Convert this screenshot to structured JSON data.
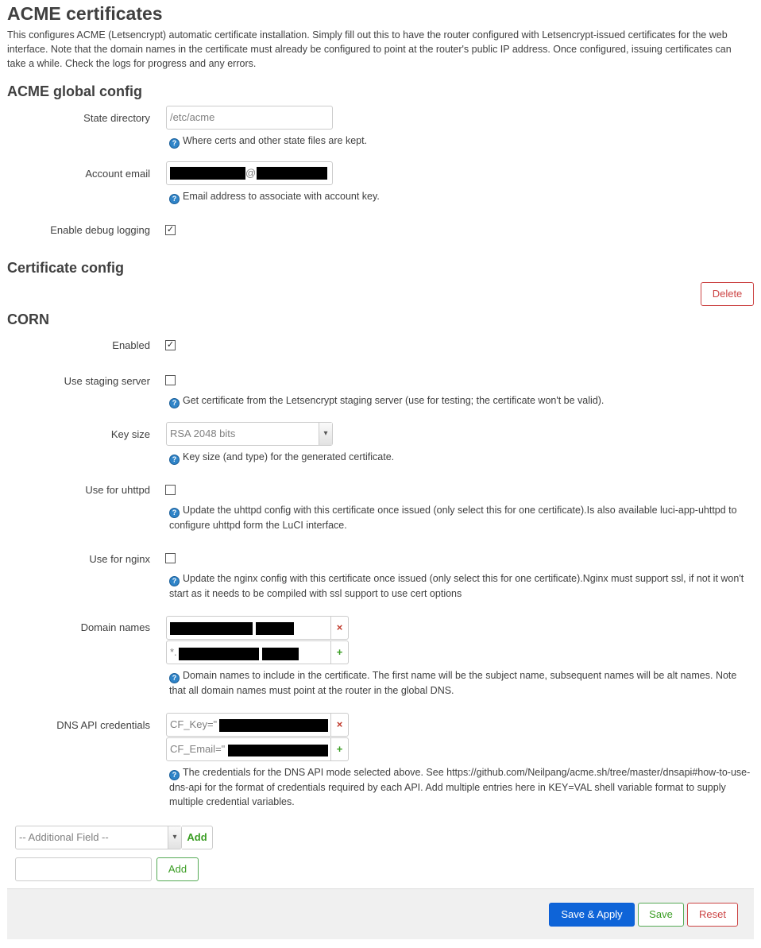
{
  "page": {
    "title": "ACME certificates",
    "description": "This configures ACME (Letsencrypt) automatic certificate installation. Simply fill out this to have the router configured with Letsencrypt-issued certificates for the web interface. Note that the domain names in the certificate must already be configured to point at the router's public IP address. Once configured, issuing certificates can take a while. Check the logs for progress and any errors."
  },
  "global": {
    "heading": "ACME global config",
    "state_dir": {
      "label": "State directory",
      "placeholder": "/etc/acme",
      "hint": "Where certs and other state files are kept."
    },
    "account_email": {
      "label": "Account email",
      "at": "@",
      "hint": "Email address to associate with account key."
    },
    "debug": {
      "label": "Enable debug logging",
      "checked": true
    }
  },
  "cert": {
    "heading": "Certificate config",
    "delete_label": "Delete",
    "section_name": "CORN",
    "enabled": {
      "label": "Enabled",
      "checked": true
    },
    "staging": {
      "label": "Use staging server",
      "checked": false,
      "hint": "Get certificate from the Letsencrypt staging server (use for testing; the certificate won't be valid)."
    },
    "key_size": {
      "label": "Key size",
      "value": "RSA 2048 bits",
      "hint": "Key size (and type) for the generated certificate."
    },
    "uhttpd": {
      "label": "Use for uhttpd",
      "checked": false,
      "hint": "Update the uhttpd config with this certificate once issued (only select this for one certificate).Is also available luci-app-uhttpd to configure uhttpd form the LuCI interface."
    },
    "nginx": {
      "label": "Use for nginx",
      "checked": false,
      "hint": "Update the nginx config with this certificate once issued (only select this for one certificate).Nginx must support ssl, if not it won't start as it needs to be compiled with ssl support to use cert options"
    },
    "domains": {
      "label": "Domain names",
      "entries": [
        {
          "prefix": "",
          "remove": "×"
        },
        {
          "prefix": "*.",
          "add": "+"
        }
      ],
      "hint": "Domain names to include in the certificate. The first name will be the subject name, subsequent names will be alt names. Note that all domain names must point at the router in the global DNS."
    },
    "dns_credentials": {
      "label": "DNS API credentials",
      "entries": [
        {
          "prefix": "CF_Key=\"",
          "remove": "×"
        },
        {
          "prefix": "CF_Email=\"",
          "add": "+"
        }
      ],
      "hint": "The credentials for the DNS API mode selected above. See https://github.com/Neilpang/acme.sh/tree/master/dnsapi#how-to-use-dns-api for the format of credentials required by each API. Add multiple entries here in KEY=VAL shell variable format to supply multiple credential variables."
    }
  },
  "additional": {
    "select_value": "-- Additional Field --",
    "add_label": "Add",
    "add_section_label": "Add"
  },
  "footer": {
    "save_apply": "Save & Apply",
    "save": "Save",
    "reset": "Reset"
  },
  "icons": {
    "help": "?",
    "check": "✓",
    "dropdown": "▾"
  }
}
